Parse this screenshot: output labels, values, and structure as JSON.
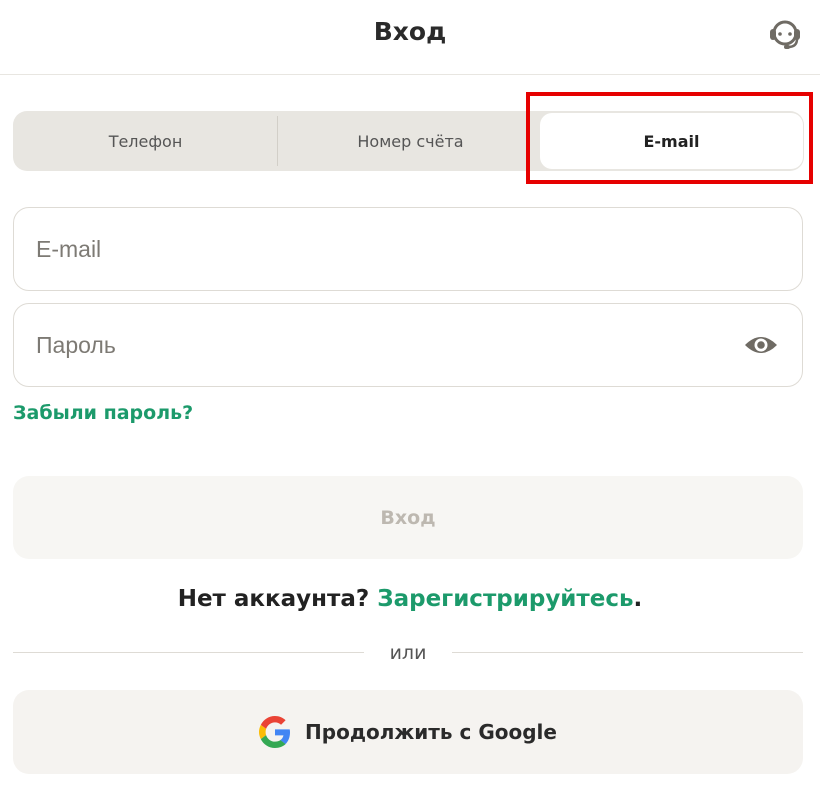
{
  "header": {
    "title": "Вход",
    "support_icon": "headset-icon"
  },
  "tabs": [
    {
      "label": "Телефон",
      "active": false
    },
    {
      "label": "Номер счёта",
      "active": false
    },
    {
      "label": "E-mail",
      "active": true
    }
  ],
  "form": {
    "email_placeholder": "E-mail",
    "email_value": "",
    "password_placeholder": "Пароль",
    "password_value": "",
    "password_toggle_icon": "eye-icon",
    "forgot_label": "Забыли пароль?",
    "login_label": "Вход"
  },
  "signup": {
    "prompt": "Нет аккаунта?",
    "link": "Зарегистрируйтесь",
    "suffix": "."
  },
  "separator": "или",
  "google": {
    "label": "Продолжить с Google",
    "icon": "google-icon"
  },
  "colors": {
    "accent_green": "#1c9a6b",
    "highlight_red": "#e60000",
    "tab_background": "#e8e6e1"
  }
}
